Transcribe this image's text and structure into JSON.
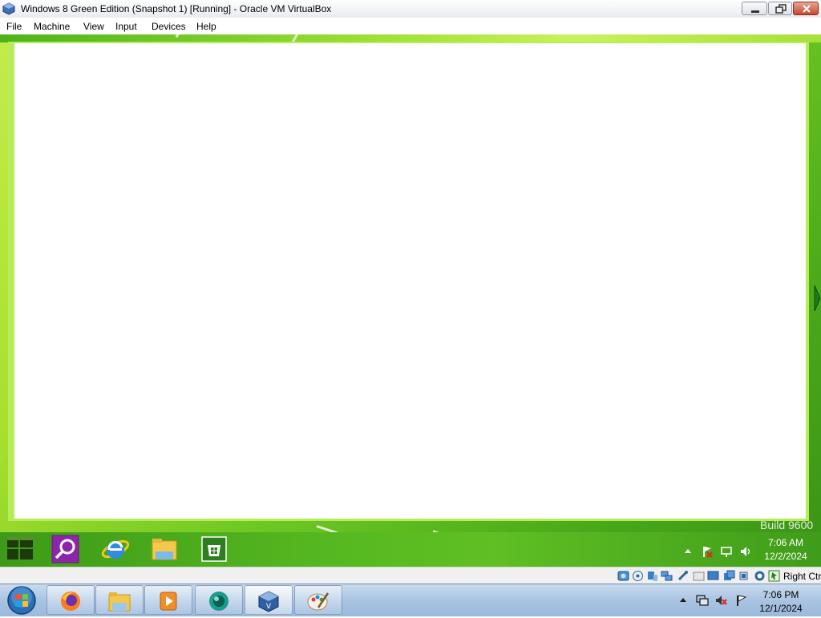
{
  "window": {
    "title": "Windows 8 Green Edition (Snapshot 1) [Running] - Oracle VM VirtualBox",
    "buttons": [
      "minimize",
      "restore",
      "close"
    ]
  },
  "menubar": {
    "items": [
      "File",
      "Machine",
      "View",
      "Input",
      "Devices",
      "Help"
    ]
  },
  "guest": {
    "watermark": "Build 9600",
    "taskbar": {
      "pinned": [
        {
          "name": "start",
          "icon": "windows-logo-icon"
        },
        {
          "name": "search",
          "icon": "search-icon"
        },
        {
          "name": "internet-explorer",
          "icon": "internet-explorer-icon"
        },
        {
          "name": "file-explorer",
          "icon": "folder-icon"
        },
        {
          "name": "store",
          "icon": "store-icon"
        }
      ],
      "tray_icons": [
        "show-hidden-icons-icon",
        "action-center-flag-icon",
        "network-icon",
        "volume-icon"
      ],
      "time": "7:06 AM",
      "date": "12/2/2024"
    },
    "colors": {
      "accent": "#5fbf24",
      "search_tile": "#8e24aa",
      "store_tile": "#2e7d1f"
    }
  },
  "statusbar": {
    "icons": [
      "hard-disk-icon",
      "optical-drive-icon",
      "audio-icon",
      "network-icon",
      "usb-icon",
      "shared-folders-icon",
      "display-icon",
      "video-capture-icon",
      "cpu-icon",
      "guest-additions-icon",
      "mouse-integration-icon",
      "keyboard-icon"
    ],
    "host_key": "Right Ctrl"
  },
  "host_taskbar": {
    "buttons": [
      {
        "name": "start",
        "icon": "windows-orb-icon"
      },
      {
        "name": "firefox",
        "icon": "firefox-icon"
      },
      {
        "name": "windows-explorer",
        "icon": "folder-icon"
      },
      {
        "name": "media-player",
        "icon": "media-player-icon"
      },
      {
        "name": "app-teal",
        "icon": "teal-app-icon"
      },
      {
        "name": "virtualbox",
        "icon": "virtualbox-icon"
      },
      {
        "name": "paint",
        "icon": "paint-icon"
      }
    ],
    "tray_icons": [
      "show-hidden-icons-icon",
      "network-icon",
      "volume-muted-icon",
      "action-center-flag-icon"
    ],
    "time": "7:06 PM",
    "date": "12/1/2024"
  }
}
